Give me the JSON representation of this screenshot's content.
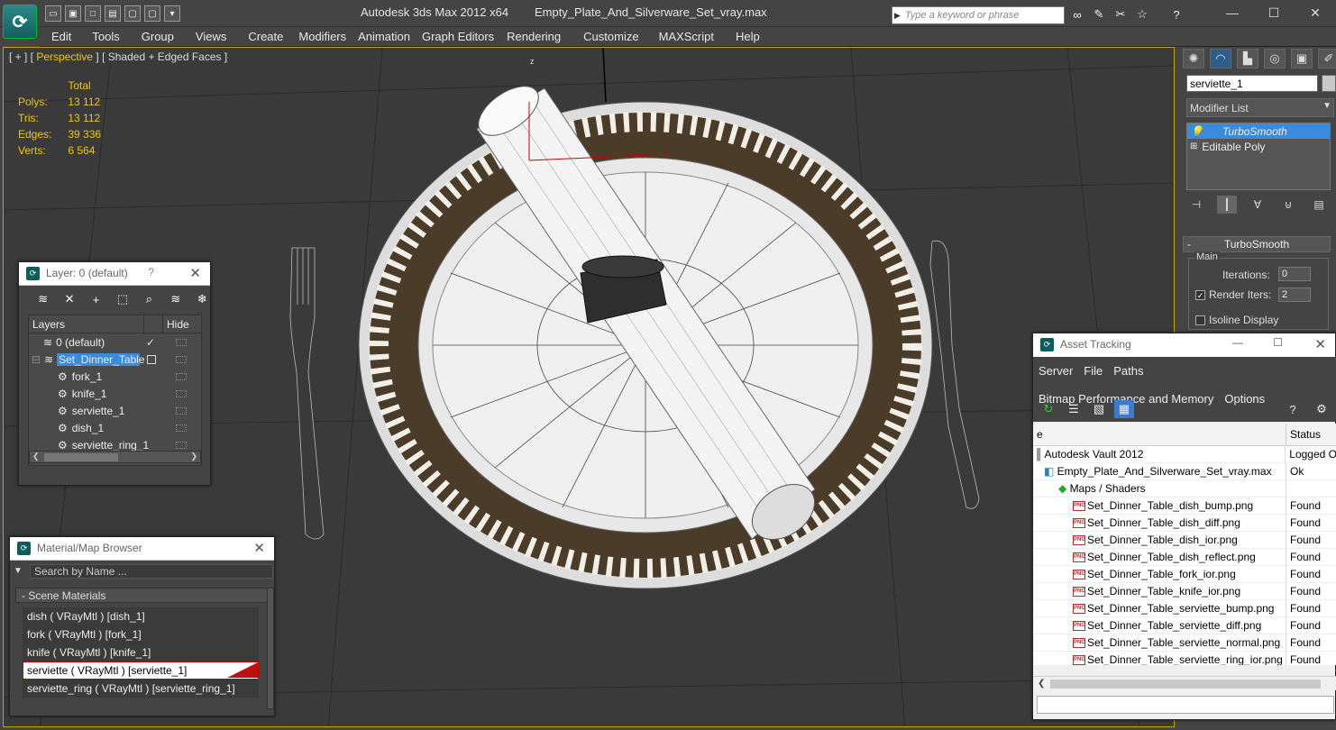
{
  "app": {
    "title": "Autodesk 3ds Max  2012 x64",
    "file": "Empty_Plate_And_Silverware_Set_vray.max",
    "search_placeholder": "Type a keyword or phrase"
  },
  "menu": [
    "Edit",
    "Tools",
    "Group",
    "Views",
    "Create",
    "Modifiers",
    "Animation",
    "Graph Editors",
    "Rendering",
    "Customize",
    "MAXScript",
    "Help"
  ],
  "viewport": {
    "label_plus": "[ + ]",
    "label_view": "Perspective",
    "label_shading": "[ Shaded + Edged Faces ]",
    "stats": {
      "header": "Total",
      "rows": [
        {
          "label": "Polys:",
          "value": "13 112"
        },
        {
          "label": "Tris:",
          "value": "13 112"
        },
        {
          "label": "Edges:",
          "value": "39 336"
        },
        {
          "label": "Verts:",
          "value": "6 564"
        }
      ]
    },
    "axis_label": "z"
  },
  "command_panel": {
    "object_name": "serviette_1",
    "modifier_list": "Modifier List",
    "stack": [
      "TurboSmooth",
      "Editable Poly"
    ],
    "rollout_title": "TurboSmooth",
    "group_main": "Main",
    "iterations_label": "Iterations:",
    "iterations_value": "0",
    "render_iters_label": "Render Iters:",
    "render_iters_value": "2",
    "isoline_label": "Isoline Display"
  },
  "layer_panel": {
    "title": "Layer: 0 (default)",
    "help": "?",
    "col_layers": "Layers",
    "col_hide": "Hide",
    "rows": [
      {
        "name": "0 (default)",
        "level": 0,
        "checked": true
      },
      {
        "name": "Set_Dinner_Table",
        "level": 0,
        "selected": true
      },
      {
        "name": "fork_1",
        "level": 1
      },
      {
        "name": "knife_1",
        "level": 1
      },
      {
        "name": "serviette_1",
        "level": 1
      },
      {
        "name": "dish_1",
        "level": 1
      },
      {
        "name": "serviette_ring_1",
        "level": 1
      }
    ]
  },
  "material_browser": {
    "title": "Material/Map Browser",
    "search_placeholder": "Search by Name ...",
    "section": "Scene Materials",
    "items": [
      {
        "label": "dish  ( VRayMtl ) [dish_1]"
      },
      {
        "label": "fork  ( VRayMtl ) [fork_1]"
      },
      {
        "label": "knife  ( VRayMtl ) [knife_1]"
      },
      {
        "label": "serviette  ( VRayMtl ) [serviette_1]",
        "selected": true
      },
      {
        "label": "serviette_ring  ( VRayMtl ) [serviette_ring_1]"
      }
    ]
  },
  "asset_tracking": {
    "title": "Asset Tracking",
    "menu": [
      "Server",
      "File",
      "Paths",
      "Bitmap Performance and Memory",
      "Options"
    ],
    "col_name": "e",
    "col_status": "Status",
    "rows": [
      {
        "name": "Autodesk Vault 2012",
        "status": "Logged O",
        "indent": 0,
        "icon": "vault"
      },
      {
        "name": "Empty_Plate_And_Silverware_Set_vray.max",
        "status": "Ok",
        "indent": 1,
        "icon": "max"
      },
      {
        "name": "Maps / Shaders",
        "status": "",
        "indent": 2,
        "icon": "maps"
      },
      {
        "name": "Set_Dinner_Table_dish_bump.png",
        "status": "Found",
        "indent": 3,
        "icon": "png"
      },
      {
        "name": "Set_Dinner_Table_dish_diff.png",
        "status": "Found",
        "indent": 3,
        "icon": "png"
      },
      {
        "name": "Set_Dinner_Table_dish_ior.png",
        "status": "Found",
        "indent": 3,
        "icon": "png"
      },
      {
        "name": "Set_Dinner_Table_dish_reflect.png",
        "status": "Found",
        "indent": 3,
        "icon": "png"
      },
      {
        "name": "Set_Dinner_Table_fork_ior.png",
        "status": "Found",
        "indent": 3,
        "icon": "png"
      },
      {
        "name": "Set_Dinner_Table_knife_ior.png",
        "status": "Found",
        "indent": 3,
        "icon": "png"
      },
      {
        "name": "Set_Dinner_Table_serviette_bump.png",
        "status": "Found",
        "indent": 3,
        "icon": "png"
      },
      {
        "name": "Set_Dinner_Table_serviette_diff.png",
        "status": "Found",
        "indent": 3,
        "icon": "png"
      },
      {
        "name": "Set_Dinner_Table_serviette_normal.png",
        "status": "Found",
        "indent": 3,
        "icon": "png"
      },
      {
        "name": "Set_Dinner_Table_serviette_ring_ior.png",
        "status": "Found",
        "indent": 3,
        "icon": "png"
      }
    ]
  },
  "colors": {
    "accent": "#f0c800",
    "selection": "#3a8bdc",
    "viewport_bg": "#3a3a3a"
  }
}
